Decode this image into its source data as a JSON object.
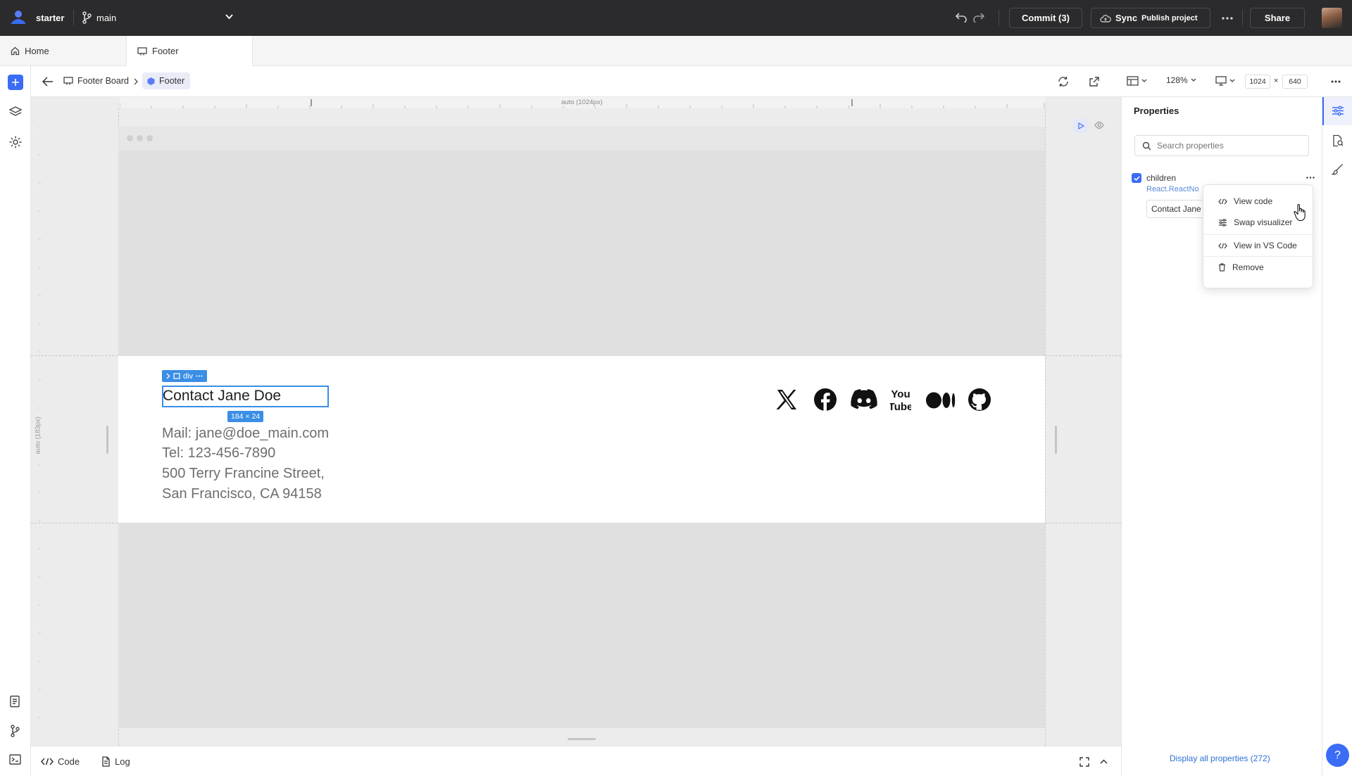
{
  "colors": {
    "accent": "#3b6cf6",
    "selection": "#3a8ee6",
    "topbar_bg": "#2b2b2d",
    "canvas_bg": "#ececec",
    "link_blue": "#2f6fd6"
  },
  "topbar": {
    "project_name": "starter",
    "branch_name": "main",
    "commit_label": "Commit (3)",
    "sync_label": "Sync",
    "publish_label": "Publish project",
    "share_label": "Share"
  },
  "tabs": [
    {
      "label": "Home",
      "icon": "home-icon"
    },
    {
      "label": "Footer",
      "icon": "board-icon"
    }
  ],
  "toolbar": {
    "breadcrumb_board": "Footer Board",
    "breadcrumb_component": "Footer",
    "zoom": "128%",
    "width": "1024",
    "height": "640",
    "size_separator": "×"
  },
  "canvas": {
    "ruler_top_label": "auto (1024px)",
    "ruler_left_label": "auto (183px)",
    "selected_tag": "div",
    "size_badge": "184 × 24",
    "contact_heading": "Contact Jane Doe",
    "contact_lines": [
      "Mail: jane@doe_main.com",
      "Tel: 123-456-7890",
      "500 Terry Francine Street,",
      "San Francisco, CA 94158"
    ],
    "social_icons": [
      "x-icon",
      "facebook-icon",
      "discord-icon",
      "youtube-icon",
      "medium-icon",
      "github-icon"
    ]
  },
  "properties": {
    "title": "Properties",
    "search_placeholder": "Search properties",
    "prop_name": "children",
    "prop_type": "React.ReactNo",
    "prop_value": "Contact Jane",
    "display_all": "Display all properties (272)"
  },
  "context_menu": {
    "items": [
      {
        "label": "View code",
        "icon": "code-icon"
      },
      {
        "label": "Swap visualizer",
        "icon": "sliders-icon"
      },
      {
        "label": "View in VS Code",
        "icon": "code-icon"
      },
      {
        "label": "Remove",
        "icon": "trash-icon"
      }
    ]
  },
  "bottombar": {
    "code_label": "Code",
    "log_label": "Log"
  },
  "help_label": "?"
}
